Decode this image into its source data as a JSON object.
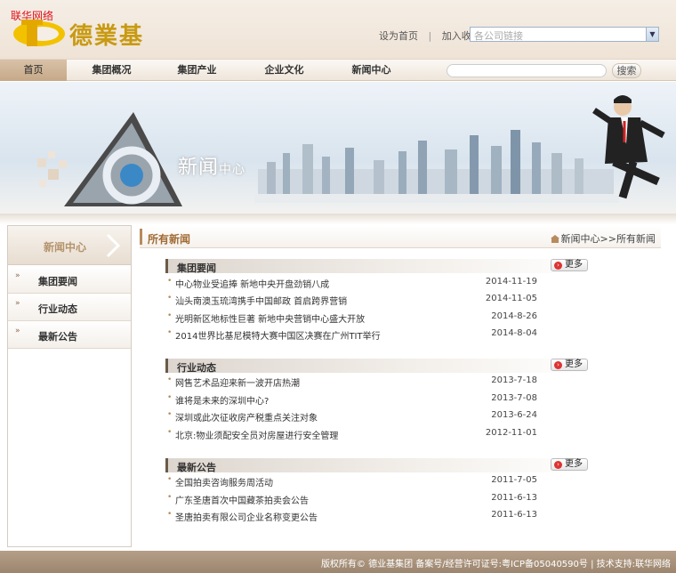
{
  "header": {
    "watermark": "联华网络",
    "logo_text": "德業基",
    "set_home": "设为首页",
    "separator": "|",
    "add_favorite": "加入收藏",
    "company_select_placeholder": "各公司链接"
  },
  "nav": {
    "items": [
      {
        "label": "首页",
        "active": true
      },
      {
        "label": "集团概况"
      },
      {
        "label": "集团产业"
      },
      {
        "label": "企业文化"
      },
      {
        "label": "新闻中心"
      }
    ],
    "search_placeholder": "",
    "search_button": "搜索"
  },
  "banner": {
    "title_main": "新闻",
    "title_sub": "中心"
  },
  "sidebar": {
    "title": "新闻中心",
    "bullet": "»",
    "items": [
      {
        "label": "集团要闻"
      },
      {
        "label": "行业动态"
      },
      {
        "label": "最新公告"
      }
    ]
  },
  "content": {
    "title": "所有新闻",
    "breadcrumb": "新闻中心>>所有新闻",
    "more_label": "更多",
    "sections": [
      {
        "title": "集团要闻",
        "items": [
          {
            "title": "中心物业受追捧  新地中央开盘劲销八成",
            "date": "2014-11-19"
          },
          {
            "title": "汕头南澳玉琉湾携手中国邮政  首启跨界营销",
            "date": "2014-11-05"
          },
          {
            "title": "光明新区地标性巨著  新地中央营销中心盛大开放",
            "date": "2014-8-26"
          },
          {
            "title": "2014世界比基尼模特大赛中国区决赛在广州TIT举行",
            "date": "2014-8-04"
          }
        ]
      },
      {
        "title": "行业动态",
        "items": [
          {
            "title": "网售艺术品迎来新一波开店热潮",
            "date": "2013-7-18"
          },
          {
            "title": "谁将是未来的深圳中心?",
            "date": "2013-7-08"
          },
          {
            "title": "深圳或此次征收房产税重点关注对象",
            "date": "2013-6-24"
          },
          {
            "title": "北京:物业须配安全员对房屋进行安全管理",
            "date": "2012-11-01"
          }
        ]
      },
      {
        "title": "最新公告",
        "items": [
          {
            "title": "全国拍卖咨询服务周活动",
            "date": "2011-7-05"
          },
          {
            "title": "广东圣唐首次中国藏茶拍卖会公告",
            "date": "2011-6-13"
          },
          {
            "title": "圣唐拍卖有限公司企业名称变更公告",
            "date": "2011-6-13"
          }
        ]
      }
    ]
  },
  "footer": {
    "text": "版权所有© 德业基集团  备案号/经营许可证号:粤ICP备05040590号  |  技术支持:联华网络"
  },
  "colors": {
    "accent": "#b78b5d",
    "nav_active": "#c6a888",
    "footer_bg": "#a8927b"
  }
}
